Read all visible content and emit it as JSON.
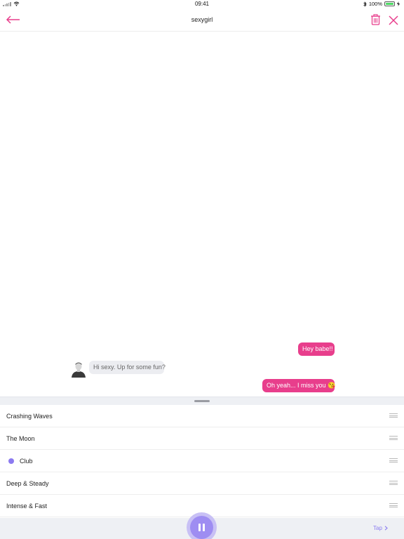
{
  "status_bar": {
    "time": "09:41",
    "battery": "100%"
  },
  "header": {
    "title": "sexygirl"
  },
  "messages": [
    {
      "from": "me",
      "text": "Hey babe!!"
    },
    {
      "from": "them",
      "text": "Hi sexy. Up for some fun?"
    },
    {
      "from": "me",
      "text": "Oh yeah... I miss you 😘"
    }
  ],
  "patterns": [
    {
      "label": "Crashing Waves",
      "active": false
    },
    {
      "label": "The Moon",
      "active": false
    },
    {
      "label": "Club",
      "active": true
    },
    {
      "label": "Deep & Steady",
      "active": false
    },
    {
      "label": "Intense & Fast",
      "active": false
    }
  ],
  "player": {
    "state": "playing",
    "tap_label": "Tap"
  },
  "colors": {
    "accent": "#e83e8c",
    "player": "#9e8df2",
    "incoming_bubble": "#ecedf1"
  }
}
